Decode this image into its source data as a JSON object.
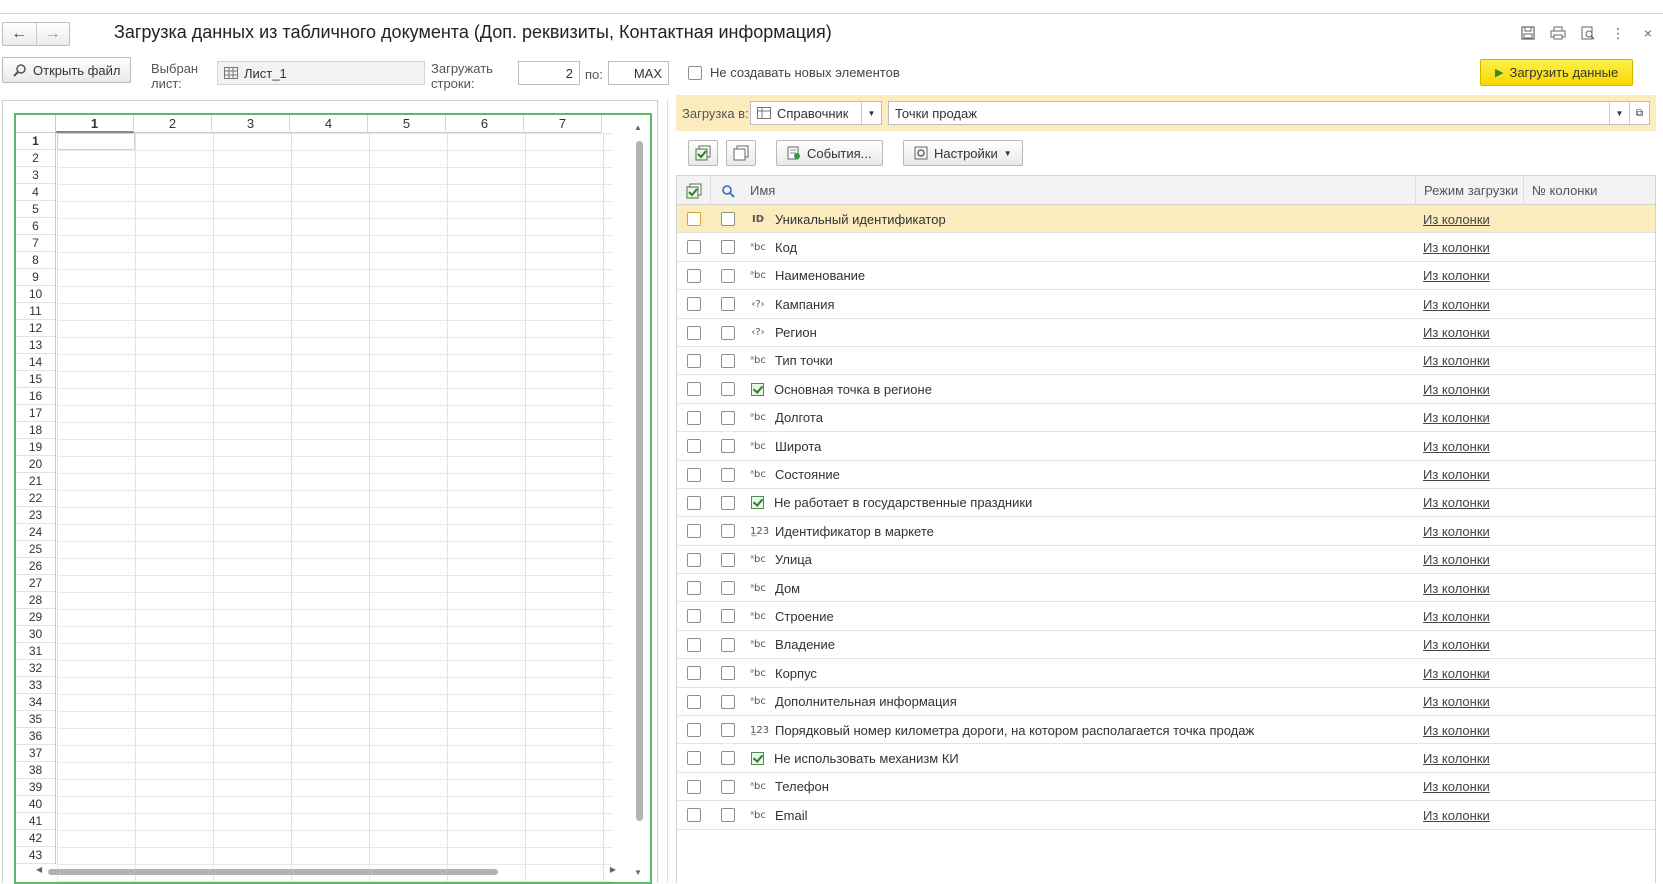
{
  "window": {
    "title": "Загрузка данных из табличного документа (Доп. реквизиты, Контактная информация)",
    "back_icon": "←",
    "forward_icon": "→"
  },
  "header_icons": [
    "save-icon",
    "print-icon",
    "preview-icon",
    "more-icon",
    "close-icon"
  ],
  "left": {
    "open_file_label": "Открыть файл",
    "sheet_label_1": "Выбран",
    "sheet_label_2": "лист:",
    "sheet_value": "Лист_1",
    "rows_label_1": "Загружать",
    "rows_label_2": "строки:",
    "rows_from": "2",
    "rows_to_label": "по:",
    "rows_to": "MAX",
    "columns": [
      "1",
      "2",
      "3",
      "4",
      "5",
      "6",
      "7"
    ],
    "rows": [
      "1",
      "2",
      "3",
      "4",
      "5",
      "6",
      "7",
      "8",
      "9",
      "10",
      "11",
      "12",
      "13",
      "14",
      "15",
      "16",
      "17",
      "18",
      "19",
      "20",
      "21",
      "22",
      "23",
      "24",
      "25",
      "26",
      "27",
      "28",
      "29",
      "30",
      "31",
      "32",
      "33",
      "34",
      "35",
      "36",
      "37",
      "38",
      "39",
      "40",
      "41",
      "42",
      "43"
    ]
  },
  "right": {
    "no_new_label": "Не создавать новых элементов",
    "load_button": "Загрузить данные",
    "load_into_label": "Загрузка в:",
    "load_into_type": "Справочник",
    "load_into_object": "Точки продаж",
    "events_label": "События...",
    "settings_label": "Настройки",
    "table_headers": {
      "name": "Имя",
      "mode": "Режим загрузки",
      "col": "№ колонки"
    },
    "rows": [
      {
        "type": "id",
        "icon": "ID",
        "name": "Уникальный идентификатор",
        "mode": "Из колонки"
      },
      {
        "type": "str",
        "icon": "ᵃbc",
        "name": "Код",
        "mode": "Из колонки"
      },
      {
        "type": "str",
        "icon": "ᵃbc",
        "name": "Наименование",
        "mode": "Из колонки"
      },
      {
        "type": "ref",
        "icon": "‹?›",
        "name": "Кампания",
        "mode": "Из колонки"
      },
      {
        "type": "ref",
        "icon": "‹?›",
        "name": "Регион",
        "mode": "Из колонки"
      },
      {
        "type": "str",
        "icon": "ᵃbc",
        "name": "Тип точки",
        "mode": "Из колонки"
      },
      {
        "type": "bool",
        "icon": "",
        "name": "Основная точка в регионе",
        "mode": "Из колонки"
      },
      {
        "type": "str",
        "icon": "ᵃbc",
        "name": "Долгота",
        "mode": "Из колонки"
      },
      {
        "type": "str",
        "icon": "ᵃbc",
        "name": "Широта",
        "mode": "Из колонки"
      },
      {
        "type": "str",
        "icon": "ᵃbc",
        "name": "Состояние",
        "mode": "Из колонки"
      },
      {
        "type": "bool",
        "icon": "",
        "name": "Не работает в государственные праздники",
        "mode": "Из колонки"
      },
      {
        "type": "num",
        "icon": "1̲23",
        "name": "Идентификатор в маркете",
        "mode": "Из колонки"
      },
      {
        "type": "str",
        "icon": "ᵃbc",
        "name": "Улица",
        "mode": "Из колонки"
      },
      {
        "type": "str",
        "icon": "ᵃbc",
        "name": "Дом",
        "mode": "Из колонки"
      },
      {
        "type": "str",
        "icon": "ᵃbc",
        "name": "Строение",
        "mode": "Из колонки"
      },
      {
        "type": "str",
        "icon": "ᵃbc",
        "name": "Владение",
        "mode": "Из колонки"
      },
      {
        "type": "str",
        "icon": "ᵃbc",
        "name": "Корпус",
        "mode": "Из колонки"
      },
      {
        "type": "str",
        "icon": "ᵃbc",
        "name": "Дополнительная информация",
        "mode": "Из колонки"
      },
      {
        "type": "num",
        "icon": "1̲23",
        "name": "Порядковый номер километра дороги, на котором располагается точка продаж",
        "mode": "Из колонки"
      },
      {
        "type": "bool",
        "icon": "",
        "name": "Не использовать механизм КИ",
        "mode": "Из колонки"
      },
      {
        "type": "str",
        "icon": "ᵃbc",
        "name": "Телефон",
        "mode": "Из колонки"
      },
      {
        "type": "str",
        "icon": "ᵃbc",
        "name": "Email",
        "mode": "Из колонки"
      }
    ]
  },
  "colors": {
    "accent_yellow": "#ffe600",
    "selection": "#fbecbd",
    "sheet_border": "#5fb86a"
  }
}
